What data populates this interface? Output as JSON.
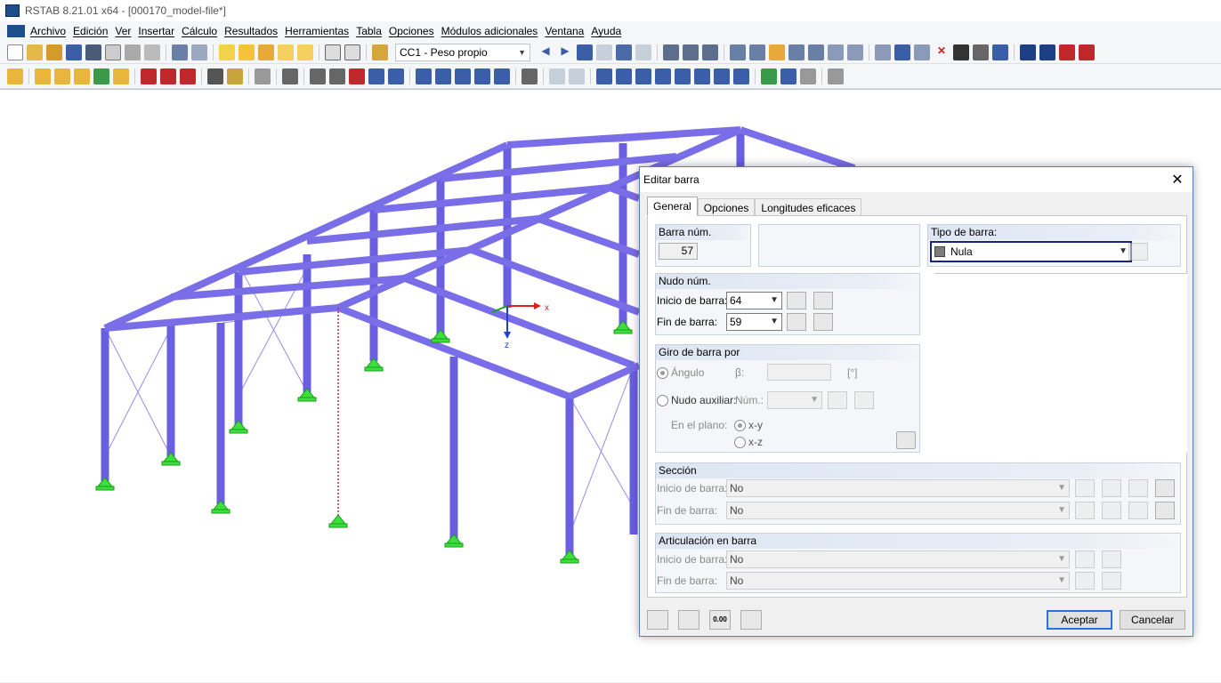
{
  "window": {
    "title": "RSTAB 8.21.01 x64 - [000170_model-file*]"
  },
  "menu": [
    "Archivo",
    "Edición",
    "Ver",
    "Insertar",
    "Cálculo",
    "Resultados",
    "Herramientas",
    "Tabla",
    "Opciones",
    "Módulos adicionales",
    "Ventana",
    "Ayuda"
  ],
  "toolbar": {
    "load_case": "CC1 - Peso propio"
  },
  "viewport": {
    "axis_x": "x",
    "axis_z": "z"
  },
  "dialog": {
    "title": "Editar barra",
    "close_icon": "close-icon",
    "tabs": [
      "General",
      "Opciones",
      "Longitudes eficaces"
    ],
    "member_no": {
      "header": "Barra núm.",
      "value": "57"
    },
    "member_type": {
      "header": "Tipo de barra:",
      "value": "Nula",
      "swatch_color": "#7c7c7c"
    },
    "nodes": {
      "header": "Nudo núm.",
      "start_label": "Inicio de barra:",
      "start_value": "64",
      "end_label": "Fin de barra:",
      "end_value": "59"
    },
    "rotation": {
      "header": "Giro de barra por",
      "angle_label": "Ángulo",
      "beta_label": "β:",
      "unit": "[°]",
      "aux_node_label": "Nudo auxiliar:",
      "num_label": "Núm.:",
      "plane_label": "En el plano:",
      "plane_xy": "x-y",
      "plane_xz": "x-z"
    },
    "section": {
      "header": "Sección",
      "start_label": "Inicio de barra:",
      "start_value": "No",
      "end_label": "Fin de barra:",
      "end_value": "No"
    },
    "hinge": {
      "header": "Articulación en barra",
      "start_label": "Inicio de barra:",
      "start_value": "No",
      "end_label": "Fin de barra:",
      "end_value": "No"
    },
    "ok_label": "Aceptar",
    "cancel_label": "Cancelar",
    "units_icon_text": "0.00"
  }
}
